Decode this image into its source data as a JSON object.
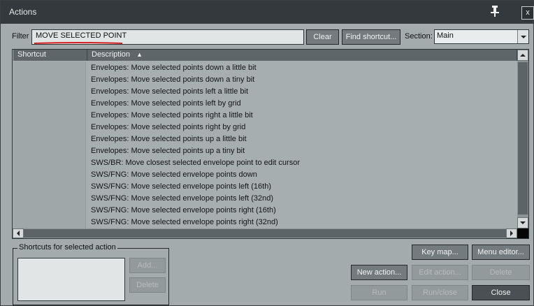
{
  "window": {
    "title": "Actions",
    "close_label": "x"
  },
  "filter": {
    "label": "Filter",
    "value": "MOVE SELECTED POINT"
  },
  "buttons": {
    "clear": "Clear",
    "find_shortcut": "Find shortcut...",
    "key_map": "Key map...",
    "menu_editor": "Menu editor...",
    "new_action": "New action...",
    "edit_action": "Edit action...",
    "delete": "Delete",
    "run": "Run",
    "run_close": "Run/close",
    "close": "Close",
    "add": "Add...",
    "delete_shortcut": "Delete"
  },
  "section": {
    "label": "Section:",
    "value": "Main"
  },
  "table": {
    "columns": {
      "shortcut": "Shortcut",
      "description": "Description",
      "sort_indicator": "▲"
    },
    "rows": [
      "Envelopes: Move selected points down a little bit",
      "Envelopes: Move selected points down a tiny bit",
      "Envelopes: Move selected points left a little bit",
      "Envelopes: Move selected points left by grid",
      "Envelopes: Move selected points right a little bit",
      "Envelopes: Move selected points right by grid",
      "Envelopes: Move selected points up a little bit",
      "Envelopes: Move selected points up a tiny bit",
      "SWS/BR: Move closest selected envelope point to edit cursor",
      "SWS/FNG: Move selected envelope points down",
      "SWS/FNG: Move selected envelope points left (16th)",
      "SWS/FNG: Move selected envelope points left (32nd)",
      "SWS/FNG: Move selected envelope points right (16th)",
      "SWS/FNG: Move selected envelope points right (32nd)"
    ]
  },
  "shortcuts_group": {
    "title": "Shortcuts for selected action"
  },
  "icons": {
    "pin": "pin-icon",
    "close": "close-icon"
  }
}
